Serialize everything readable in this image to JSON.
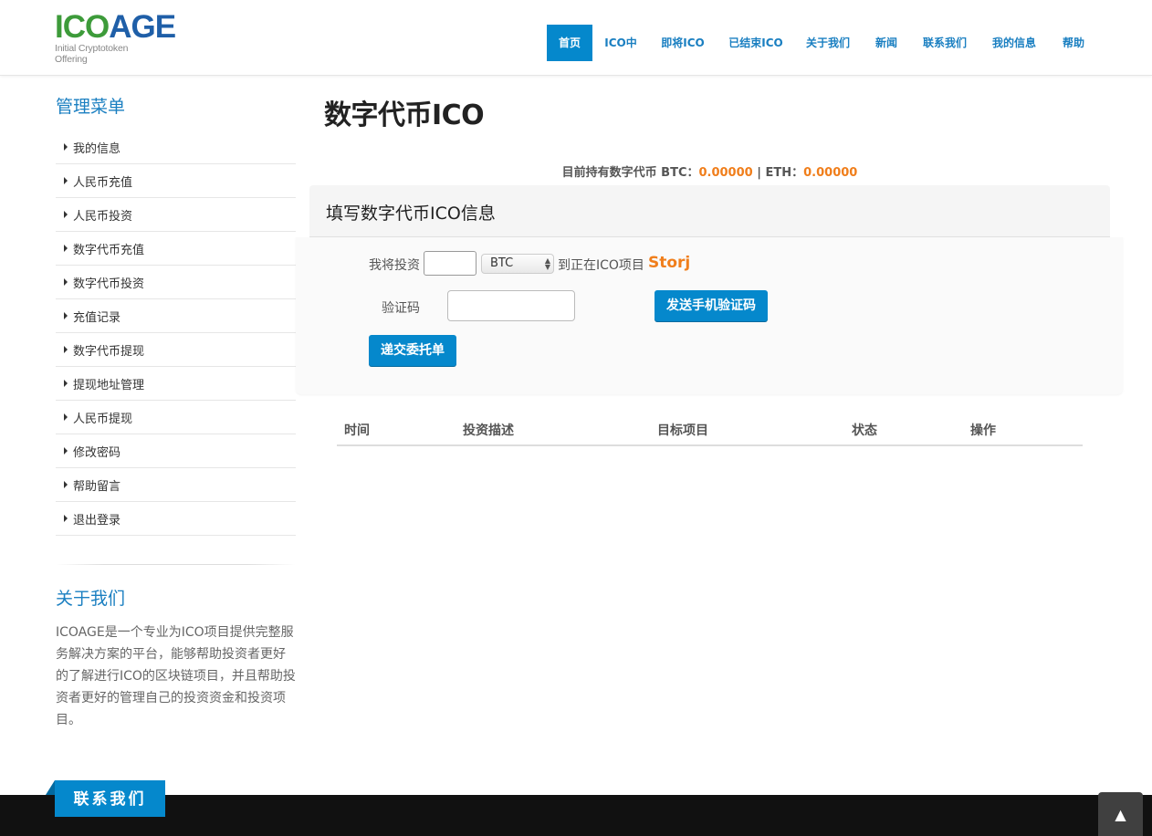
{
  "logo": {
    "main_a": "ICO",
    "main_b": "AGE",
    "sub": "Initial Cryptotoken Offering"
  },
  "nav": [
    {
      "label": "首页",
      "active": true
    },
    {
      "label": "ICO中"
    },
    {
      "label": "即将ICO"
    },
    {
      "label": "已结束ICO"
    },
    {
      "label": "关于我们"
    },
    {
      "label": "新闻"
    },
    {
      "label": "联系我们"
    },
    {
      "label": "我的信息"
    },
    {
      "label": "帮助"
    }
  ],
  "sidebar": {
    "title": "管理菜单",
    "items": [
      {
        "label": "我的信息"
      },
      {
        "label": "人民币充值"
      },
      {
        "label": "人民币投资"
      },
      {
        "label": "数字代币充值"
      },
      {
        "label": "数字代币投资"
      },
      {
        "label": "充值记录"
      },
      {
        "label": "数字代币提现"
      },
      {
        "label": "提现地址管理"
      },
      {
        "label": "人民币提现"
      },
      {
        "label": "修改密码"
      },
      {
        "label": "帮助留言"
      },
      {
        "label": "退出登录"
      }
    ]
  },
  "about": {
    "title": "关于我们",
    "text": "ICOAGE是一个专业为ICO项目提供完整服务解决方案的平台，能够帮助投资者更好的了解进行ICO的区块链项目，并且帮助投资者更好的管理自己的投资资金和投资项目。"
  },
  "main": {
    "title": "数字代币ICO",
    "holdings": {
      "prefix": "目前持有数字代币 BTC：",
      "btc": "0.00000",
      "sep": " | ETH：",
      "eth": "0.00000"
    },
    "panel_title": "填写数字代币ICO信息",
    "form": {
      "invest_label": "我将投资",
      "amount_value": "",
      "currency_selected": "BTC",
      "to_project_label": "到正在ICO项目",
      "project_name": "Storj",
      "captcha_label": "验证码",
      "captcha_value": "",
      "send_code_button": "发送手机验证码",
      "submit_button": "递交委托单"
    },
    "table": {
      "columns": [
        "时间",
        "投资描述",
        "目标项目",
        "状态",
        "操作"
      ],
      "rows": []
    }
  },
  "footer": {
    "contact_tab": "联系我们",
    "to_top": "▲"
  },
  "colors": {
    "accent": "#0588cc",
    "highlight": "#f07e1b",
    "footer": "#111111"
  }
}
